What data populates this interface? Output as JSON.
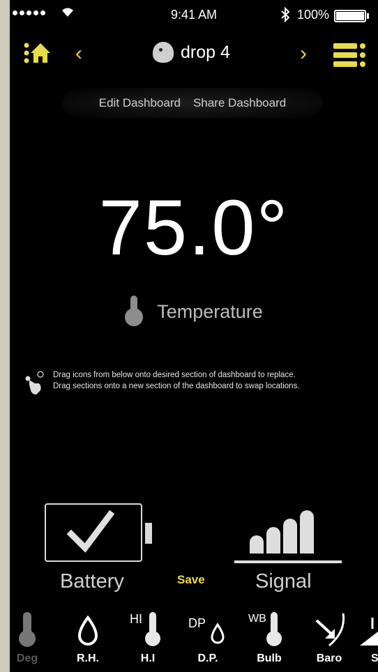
{
  "status_bar": {
    "time": "9:41 AM",
    "battery_percent": "100%"
  },
  "nav": {
    "prev_label": "‹",
    "next_label": "›",
    "device_name": "drop 4"
  },
  "dashboard_links": {
    "edit": "Edit Dashboard",
    "share": "Share Dashboard"
  },
  "main": {
    "value": "75.0°",
    "metric_label": "Temperature"
  },
  "hint": {
    "line1": "Drag icons from below onto desired section of dashboard to replace.",
    "line2": "Drag sections onto a new section of the dashboard to swap locations."
  },
  "tiles": {
    "battery_label": "Battery",
    "save_label": "Save",
    "signal_label": "Signal"
  },
  "tray": [
    {
      "label": "Deg",
      "icon": "thermometer-icon"
    },
    {
      "label": "R.H.",
      "icon": "humidity-drop-icon"
    },
    {
      "label": "H.I",
      "icon": "heat-index-icon"
    },
    {
      "label": "D.P.",
      "icon": "dew-point-icon"
    },
    {
      "label": "Bulb",
      "icon": "wet-bulb-icon"
    },
    {
      "label": "Baro",
      "icon": "barometer-icon"
    },
    {
      "label": "S",
      "icon": "wind-icon"
    }
  ],
  "colors": {
    "accent": "#e9dd47",
    "background": "#000000",
    "text": "#ffffff"
  }
}
